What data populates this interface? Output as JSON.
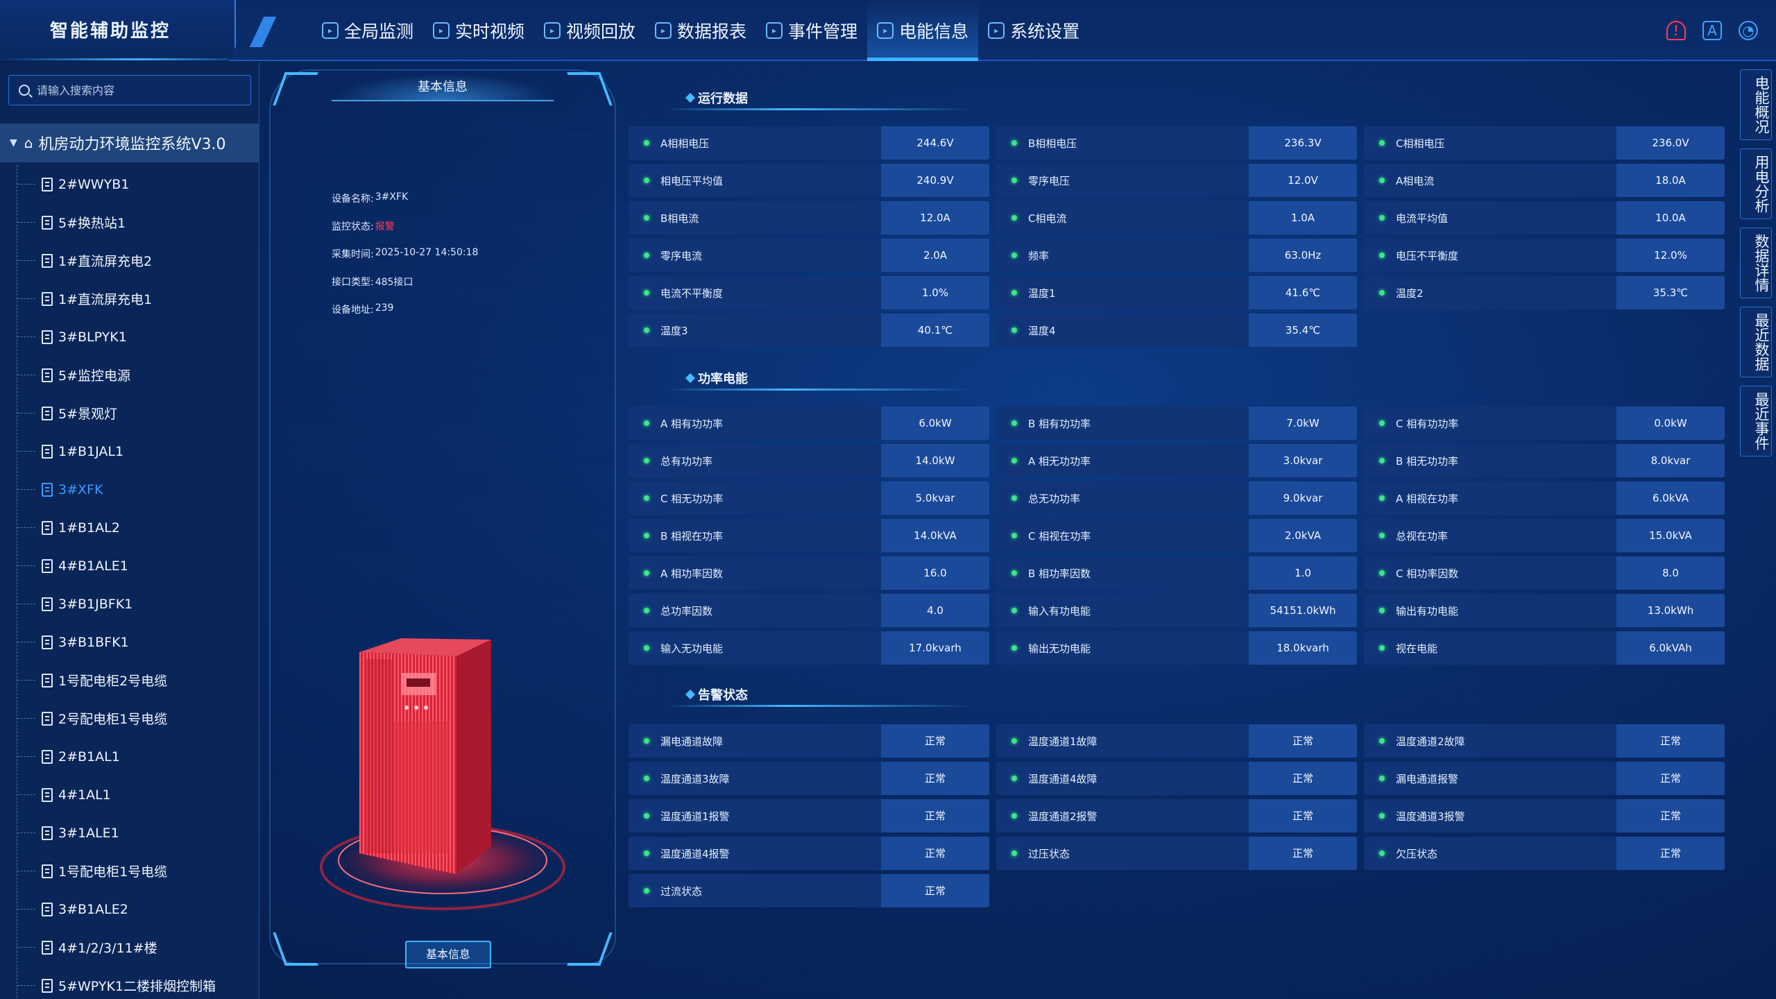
{
  "app": {
    "title": "智能辅助监控"
  },
  "nav": {
    "items": [
      {
        "label": "全局监测",
        "icon": "globe-icon",
        "active": false
      },
      {
        "label": "实时视频",
        "icon": "video-icon",
        "active": false
      },
      {
        "label": "视频回放",
        "icon": "replay-icon",
        "active": false
      },
      {
        "label": "数据报表",
        "icon": "report-icon",
        "active": false
      },
      {
        "label": "事件管理",
        "icon": "event-icon",
        "active": false
      },
      {
        "label": "电能信息",
        "icon": "power-icon",
        "active": true
      },
      {
        "label": "系统设置",
        "icon": "settings-icon",
        "active": false
      }
    ],
    "right_icons": [
      "alarm-icon",
      "font-icon",
      "user-icon"
    ]
  },
  "sidebar": {
    "search_placeholder": "请输入搜索内容",
    "root_label": "机房动力环境监控系统V3.0",
    "items": [
      "2#WWYB1",
      "5#换热站1",
      "1#直流屏充电2",
      "1#直流屏充电1",
      "3#BLPYK1",
      "5#监控电源",
      "5#景观灯",
      "1#B1JAL1",
      "3#XFK",
      "1#B1AL2",
      "4#B1ALE1",
      "3#B1JBFK1",
      "3#B1BFK1",
      "1号配电柜2号电缆",
      "2号配电柜1号电缆",
      "2#B1AL1",
      "4#1AL1",
      "3#1ALE1",
      "1号配电柜1号电缆",
      "3#B1ALE2",
      "4#1/2/3/11#楼",
      "5#WPYK1二楼排烟控制箱"
    ],
    "selected_index": 8
  },
  "device": {
    "panel_title": "基本信息",
    "fields": [
      {
        "label": "设备名称:",
        "value": "3#XFK",
        "alarm": false
      },
      {
        "label": "监控状态:",
        "value": "报警",
        "alarm": true
      },
      {
        "label": "采集时间:",
        "value": "2025-10-27 14:50:18",
        "alarm": false
      },
      {
        "label": "接口类型:",
        "value": "485接口",
        "alarm": false
      },
      {
        "label": "设备地址:",
        "value": "239",
        "alarm": false
      }
    ],
    "footer_tab": "基本信息",
    "accent_color": "#ff2a3d"
  },
  "sections": {
    "running": {
      "title": "运行数据",
      "cells": [
        {
          "k": "A相相电压",
          "v": "244.6V"
        },
        {
          "k": "B相相电压",
          "v": "236.3V"
        },
        {
          "k": "C相相电压",
          "v": "236.0V"
        },
        {
          "k": "相电压平均值",
          "v": "240.9V"
        },
        {
          "k": "零序电压",
          "v": "12.0V"
        },
        {
          "k": "A相电流",
          "v": "18.0A"
        },
        {
          "k": "B相电流",
          "v": "12.0A"
        },
        {
          "k": "C相电流",
          "v": "1.0A"
        },
        {
          "k": "电流平均值",
          "v": "10.0A"
        },
        {
          "k": "零序电流",
          "v": "2.0A"
        },
        {
          "k": "频率",
          "v": "63.0Hz"
        },
        {
          "k": "电压不平衡度",
          "v": "12.0%"
        },
        {
          "k": "电流不平衡度",
          "v": "1.0%"
        },
        {
          "k": "温度1",
          "v": "41.6℃"
        },
        {
          "k": "温度2",
          "v": "35.3℃"
        },
        {
          "k": "温度3",
          "v": "40.1℃"
        },
        {
          "k": "温度4",
          "v": "35.4℃"
        }
      ]
    },
    "power": {
      "title": "功率电能",
      "cells": [
        {
          "k": "A 相有功功率",
          "v": "6.0kW"
        },
        {
          "k": "B 相有功功率",
          "v": "7.0kW"
        },
        {
          "k": "C 相有功功率",
          "v": "0.0kW"
        },
        {
          "k": "总有功功率",
          "v": "14.0kW"
        },
        {
          "k": "A 相无功功率",
          "v": "3.0kvar"
        },
        {
          "k": "B 相无功功率",
          "v": "8.0kvar"
        },
        {
          "k": "C 相无功功率",
          "v": "5.0kvar"
        },
        {
          "k": "总无功功率",
          "v": "9.0kvar"
        },
        {
          "k": "A 相视在功率",
          "v": "6.0kVA"
        },
        {
          "k": "B 相视在功率",
          "v": "14.0kVA"
        },
        {
          "k": "C 相视在功率",
          "v": "2.0kVA"
        },
        {
          "k": "总视在功率",
          "v": "15.0kVA"
        },
        {
          "k": "A 相功率因数",
          "v": "16.0"
        },
        {
          "k": "B 相功率因数",
          "v": "1.0"
        },
        {
          "k": "C 相功率因数",
          "v": "8.0"
        },
        {
          "k": "总功率因数",
          "v": "4.0"
        },
        {
          "k": "输入有功电能",
          "v": "54151.0kWh"
        },
        {
          "k": "输出有功电能",
          "v": "13.0kWh"
        },
        {
          "k": "输入无功电能",
          "v": "17.0kvarh"
        },
        {
          "k": "输出无功电能",
          "v": "18.0kvarh"
        },
        {
          "k": "视在电能",
          "v": "6.0kVAh"
        }
      ]
    },
    "alarm": {
      "title": "告警状态",
      "cells": [
        {
          "k": "漏电通道故障",
          "v": "正常"
        },
        {
          "k": "温度通道1故障",
          "v": "正常"
        },
        {
          "k": "温度通道2故障",
          "v": "正常"
        },
        {
          "k": "温度通道3故障",
          "v": "正常"
        },
        {
          "k": "温度通道4故障",
          "v": "正常"
        },
        {
          "k": "漏电通道报警",
          "v": "正常"
        },
        {
          "k": "温度通道1报警",
          "v": "正常"
        },
        {
          "k": "温度通道2报警",
          "v": "正常"
        },
        {
          "k": "温度通道3报警",
          "v": "正常"
        },
        {
          "k": "温度通道4报警",
          "v": "正常"
        },
        {
          "k": "过压状态",
          "v": "正常"
        },
        {
          "k": "欠压状态",
          "v": "正常"
        },
        {
          "k": "过流状态",
          "v": "正常"
        }
      ]
    }
  },
  "right_tabs": [
    "电能概况",
    "用电分析",
    "数据详情",
    "最近数据",
    "最近事件"
  ],
  "colors": {
    "status_dot": "#3ae68a",
    "accent": "#3cb4ff",
    "alarm": "#ff3b4e"
  }
}
